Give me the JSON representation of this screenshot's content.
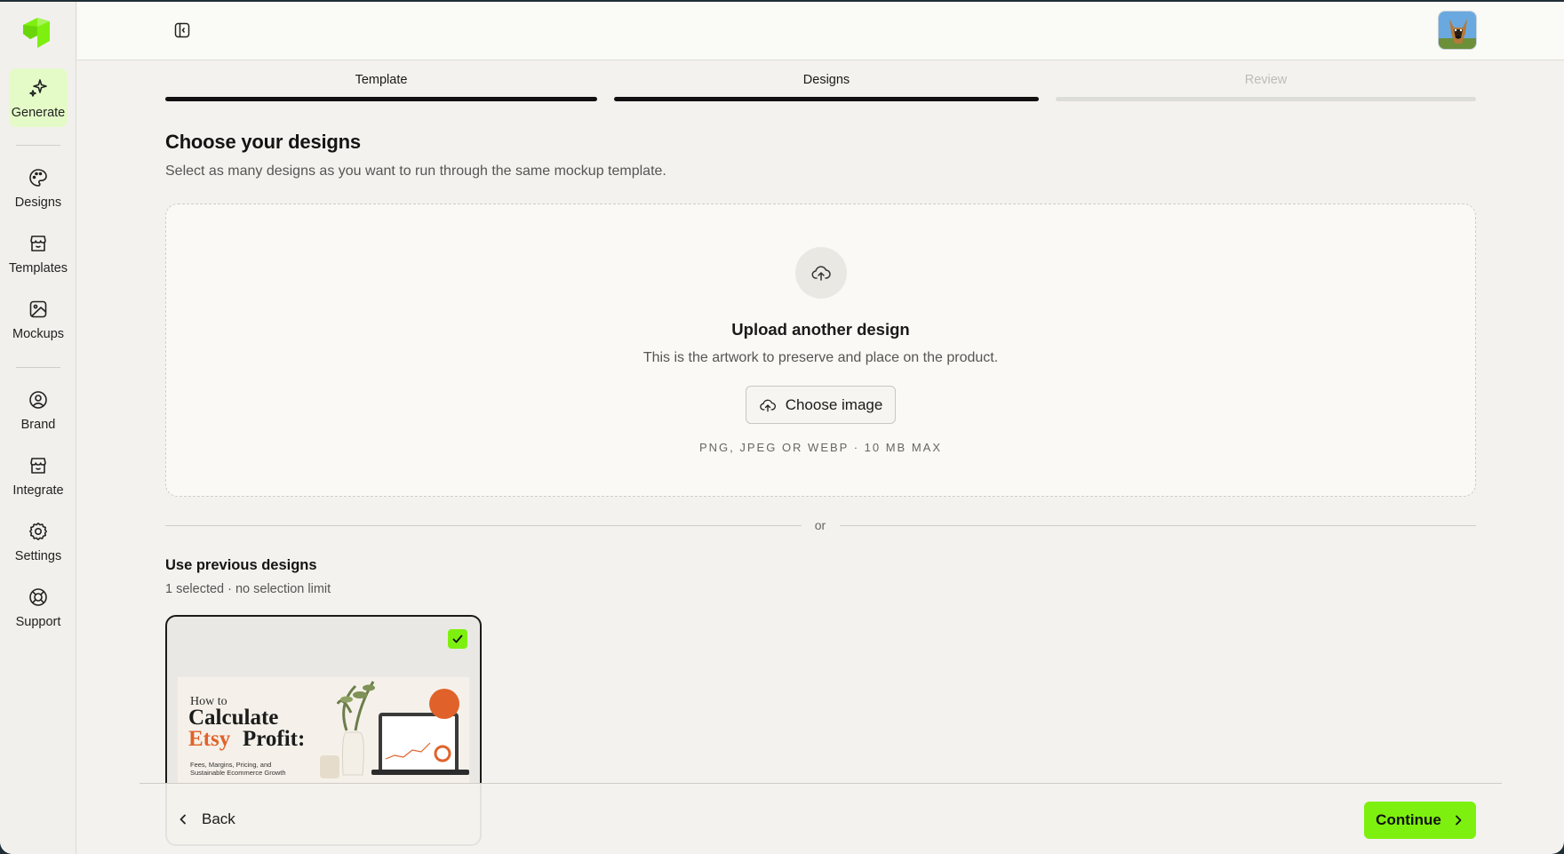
{
  "sidebar": {
    "items": [
      {
        "label": "Generate",
        "icon": "sparkles-icon",
        "active": true
      },
      {
        "label": "Designs",
        "icon": "palette-icon"
      },
      {
        "label": "Templates",
        "icon": "store-icon"
      },
      {
        "label": "Mockups",
        "icon": "image-icon"
      },
      {
        "label": "Brand",
        "icon": "user-circle-icon"
      },
      {
        "label": "Integrate",
        "icon": "store-icon"
      },
      {
        "label": "Settings",
        "icon": "gear-icon"
      },
      {
        "label": "Support",
        "icon": "lifebuoy-icon"
      }
    ]
  },
  "steps": [
    {
      "label": "Template",
      "state": "complete"
    },
    {
      "label": "Designs",
      "state": "active"
    },
    {
      "label": "Review",
      "state": "upcoming"
    }
  ],
  "main": {
    "title": "Choose your designs",
    "subtitle": "Select as many designs as you want to run through the same mockup template.",
    "upload": {
      "title": "Upload another design",
      "description": "This is the artwork to preserve and place on the product.",
      "button_label": "Choose image",
      "formats": "PNG, JPEG OR WEBP · 10 MB MAX"
    },
    "divider_text": "or",
    "previous": {
      "title": "Use previous designs",
      "selection_info": "1 selected · no selection limit",
      "cards": [
        {
          "selected": true,
          "thumb_text": {
            "line1": "How to",
            "line2": "Calculate",
            "line3a": "Etsy",
            "line3b": "Profit:",
            "small": "Fees, Margins, Pricing, and Sustainable Ecommerce Growth"
          }
        }
      ]
    }
  },
  "footer": {
    "back_label": "Back",
    "continue_label": "Continue"
  },
  "colors": {
    "accent": "#7ef00f",
    "active_nav_bg": "#e4fbc8",
    "step_complete": "#111111",
    "step_upcoming": "#dcdcd8"
  }
}
